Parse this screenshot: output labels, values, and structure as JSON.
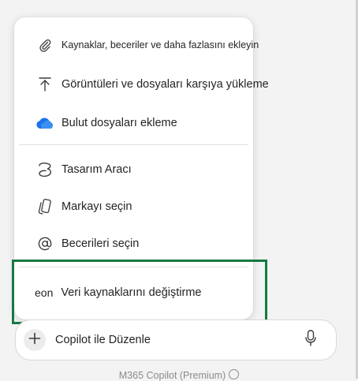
{
  "menu": {
    "items": [
      {
        "id": "add-resources",
        "label": "Kaynaklar, beceriler ve daha fazlasını ekleyin",
        "icon": "paperclip-icon"
      },
      {
        "id": "upload-images-files",
        "label": "Görüntüleri ve dosyaları karşıya yükleme",
        "icon": "upload-icon"
      },
      {
        "id": "add-cloud-files",
        "label": "Bulut dosyaları ekleme",
        "icon": "cloud-icon"
      },
      {
        "id": "design-tool",
        "label": "Tasarım Aracı",
        "icon": "designer-icon"
      },
      {
        "id": "select-brand",
        "label": "Markayı seçin",
        "icon": "brand-kit-icon"
      },
      {
        "id": "select-skills",
        "label": "Becerileri seçin",
        "icon": "at-icon"
      },
      {
        "id": "change-data-sources",
        "label": "Veri kaynaklarını değiştirme",
        "prefix": "eon"
      }
    ]
  },
  "composer": {
    "placeholder": "Copilot ile Düzenle",
    "add_icon": "plus-icon",
    "mic_icon": "microphone-icon"
  },
  "footer": {
    "label": "M365 Copilot (Premium)",
    "icon": "info-icon"
  },
  "colors": {
    "highlight": "#137a43",
    "cloud": "#1a73e8"
  }
}
